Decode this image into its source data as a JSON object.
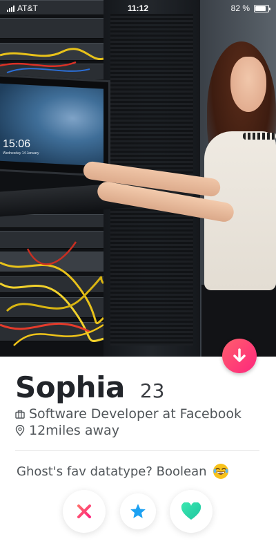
{
  "status_bar": {
    "carrier": "AT&T",
    "time": "11:12",
    "battery": "82 %",
    "battery_level": 0.82
  },
  "photo": {
    "screen_clock": "15:06",
    "screen_date": "Wednesday 14 January"
  },
  "profile": {
    "name": "Sophia",
    "age": "23",
    "job": "Software Developer at Facebook",
    "distance": "12miles away",
    "bio": "Ghost's fav datatype? Boolean"
  },
  "icons": {
    "info": "arrow-down-icon",
    "job": "briefcase-icon",
    "distance": "location-pin-icon",
    "emoji": "laughing-emoji-icon",
    "nope": "close-icon",
    "super_like": "star-icon",
    "like": "heart-icon"
  },
  "colors": {
    "accent_gradient_start": "#ff5f6d",
    "accent_gradient_end": "#fd267d",
    "nope": "#fd4c5c",
    "super_like": "#1da1f2",
    "like": "#2ed3a5"
  }
}
